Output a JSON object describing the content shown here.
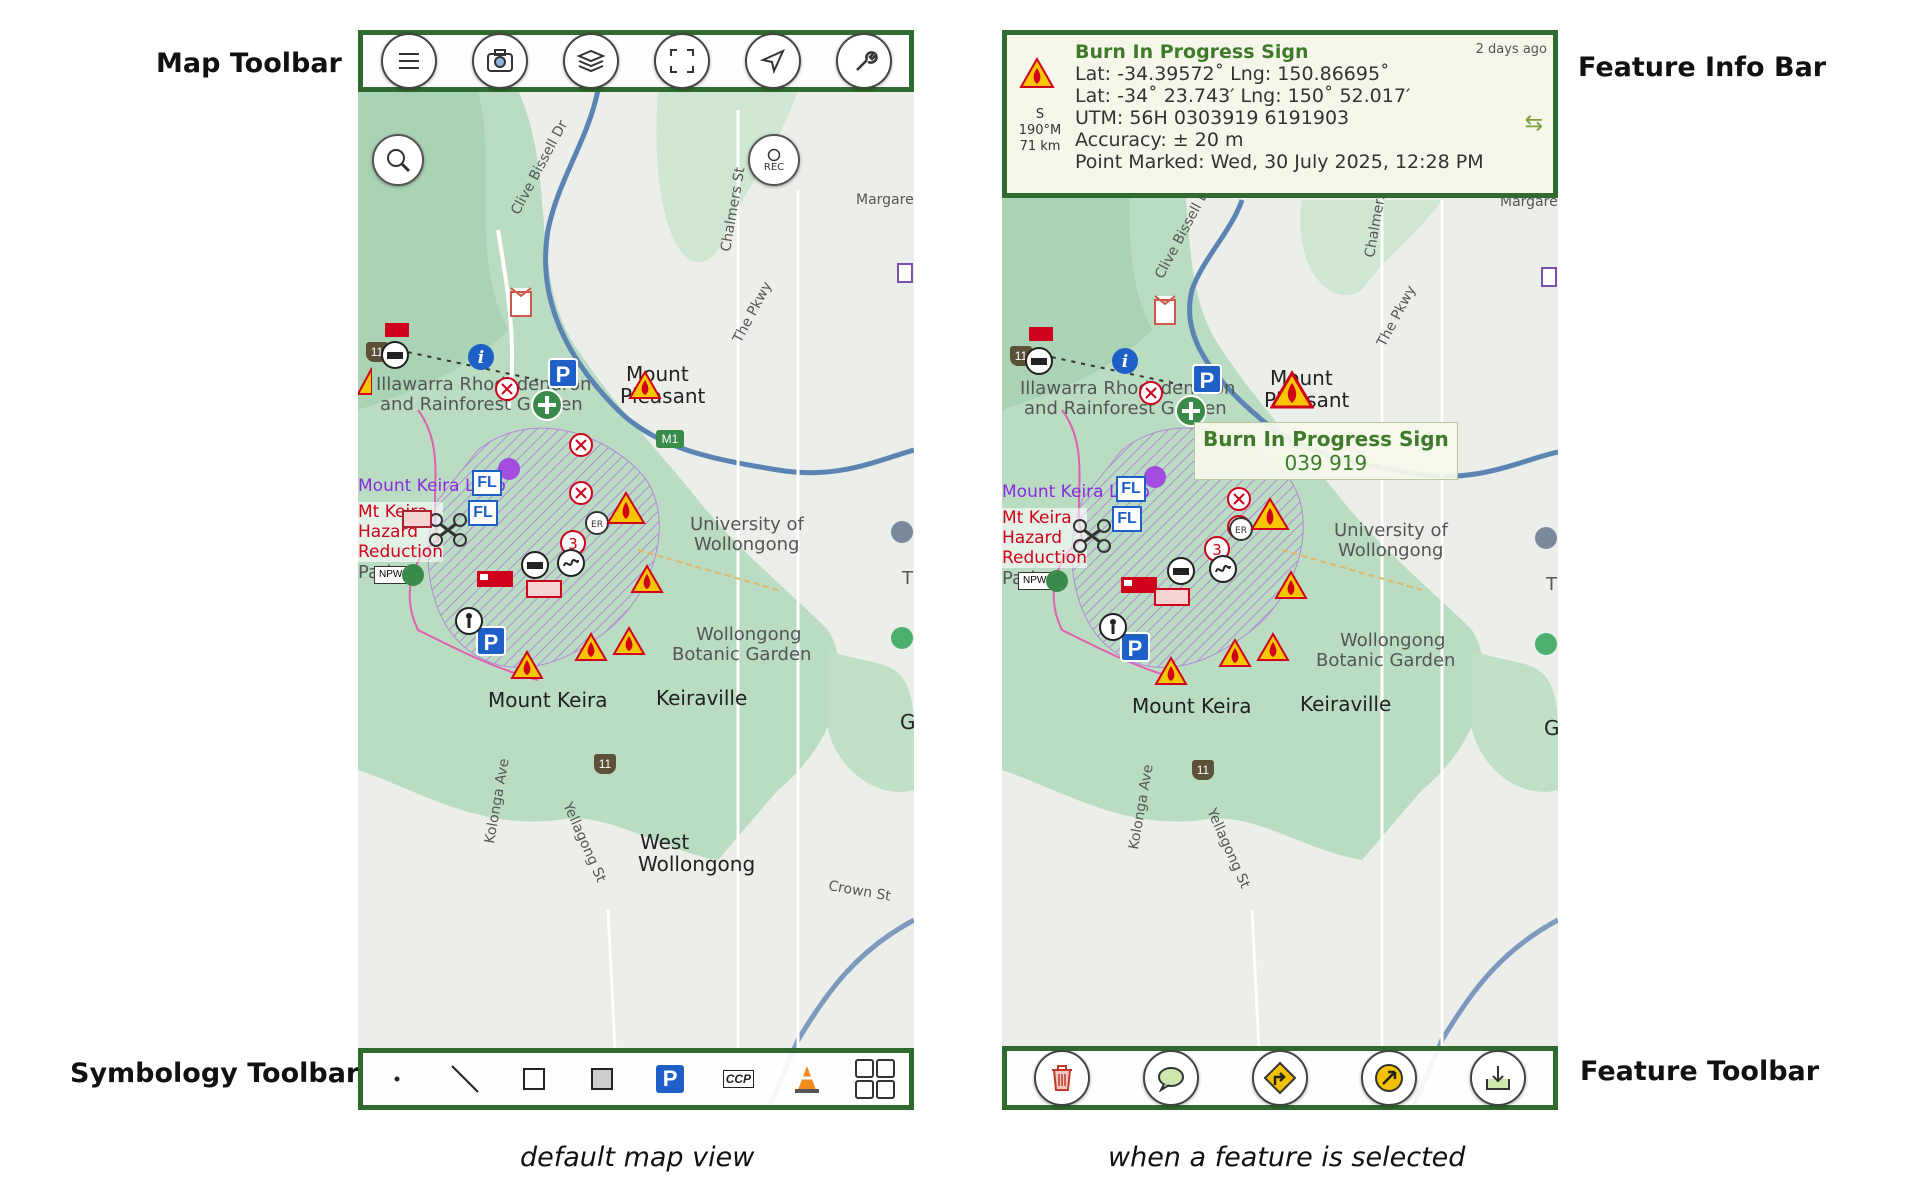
{
  "labels": {
    "map_toolbar": "Map Toolbar",
    "symbology_toolbar": "Symbology Toolbar",
    "feature_info_bar": "Feature Info Bar",
    "feature_toolbar": "Feature Toolbar"
  },
  "captions": {
    "left": "default map view",
    "right": "when a feature is selected"
  },
  "map_toolbar": {
    "buttons": [
      "menu-icon",
      "camera-icon",
      "layers-icon",
      "fullscreen-icon",
      "location-arrow-icon",
      "wrench-icon"
    ]
  },
  "map_controls": {
    "rec_label": "REC"
  },
  "symbology_toolbar": {
    "items": [
      "point-icon",
      "line-icon",
      "polygon-icon",
      "filled-square-icon",
      "parking-icon",
      "ccp-icon",
      "traffic-cone-icon",
      "grid-icon"
    ],
    "ccp_text": "CCP",
    "parking_text": "P"
  },
  "feature_toolbar": {
    "buttons": [
      "trash-icon",
      "comment-icon",
      "directions-icon",
      "edit-arrow-icon",
      "export-icon"
    ]
  },
  "feature_info": {
    "title": "Burn In Progress Sign",
    "ago": "2 days ago",
    "lat_lng_dec": "Lat: -34.39572˚   Lng: 150.86695˚",
    "lat_lng_dm": "Lat: -34˚ 23.743′   Lng: 150˚ 52.017′",
    "utm": "UTM: 56H  0303919  6191903",
    "accuracy": "Accuracy: ± 20 m",
    "marked": "Point Marked: Wed, 30 July 2025, 12:28 PM",
    "dir_letter": "S",
    "bearing": "190°M",
    "distance": "71 km",
    "swap_icon": "swap-icon"
  },
  "tooltip": {
    "title": "Burn In Progress Sign",
    "code": "039 919"
  },
  "map": {
    "mount_pleasant_a": "Mount",
    "mount_pleasant_b": "Pleasant",
    "mount_keira": "Mount Keira",
    "keiraville": "Keiraville",
    "university_a": "University of",
    "university_b": "Wollongong",
    "botanic_a": "Wollongong",
    "botanic_b": "Botanic Garden",
    "rhodo_a": "Illawarra Rhododendron",
    "rhodo_b": "and Rainforest Garden",
    "loop": "Mount Keira Loop",
    "hazard": "Mt Keira\nHazard\nReduction",
    "clive": "Clive Bissell Dr",
    "chalmers": "Chalmers St",
    "pkwy": "The Pkwy",
    "margaret": "Margaret",
    "kolonga": "Kolonga Ave",
    "yellagong": "Yellagong St",
    "west_wollongong_a": "West",
    "west_wollongong_b": "Wollongong",
    "crown": "Crown St",
    "route11": "11",
    "m1": "M1",
    "npws": "NPWS",
    "fl": "FL",
    "g": "G",
    "t": "T",
    "park_text": "Park",
    "er": "ER",
    "three": "3"
  },
  "colors": {
    "toolbar_border": "#2f6b2f",
    "title_green": "#3e7a2a",
    "parking_blue": "#1e5fc8",
    "hazard_red": "#d0021b",
    "park_green": "#b7dcc0"
  }
}
